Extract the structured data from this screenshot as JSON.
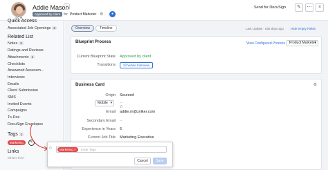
{
  "header": {
    "name": "Addie Mason",
    "rating": "4.0 ★",
    "status_badge": "Approved by client",
    "for_label": "for",
    "job_opening": "Product Marketer",
    "docusign_label": "Send for DocuSign"
  },
  "sidebar": {
    "quick_access": "Quick Access",
    "associated": "Associated Job Openings",
    "associated_count": "2",
    "related_list": "Related List",
    "items": [
      {
        "label": "Notes",
        "count": "2"
      },
      {
        "label": "Ratings and Reviews",
        "count": ""
      },
      {
        "label": "Attachments",
        "count": "1"
      },
      {
        "label": "Checklists",
        "count": ""
      },
      {
        "label": "Answered Assessm...",
        "count": ""
      },
      {
        "label": "Interviews",
        "count": ""
      },
      {
        "label": "Emails",
        "count": ""
      },
      {
        "label": "Client Submission",
        "count": ""
      },
      {
        "label": "SMS",
        "count": ""
      },
      {
        "label": "Invited Events",
        "count": ""
      },
      {
        "label": "Campaigns",
        "count": ""
      },
      {
        "label": "To-Dos",
        "count": ""
      },
      {
        "label": "DocuSign Envelopes",
        "count": ""
      }
    ],
    "tags_heading": "Tags",
    "tags_count": "1",
    "tag": "Marketing",
    "links_heading": "Links",
    "whats_this": "What's this?"
  },
  "main": {
    "tabs": [
      "Overview",
      "Timeline"
    ],
    "last_update": "Last Update : 835 days ago",
    "hide_fields": "Hide empty Fields",
    "blueprint": {
      "title": "Blueprint Process",
      "view_link": "View Configured Process",
      "process_select": "Product Marketer",
      "state_label": "Current Blueprint State",
      "state_value": "Approved by client",
      "transitions_label": "Transitions",
      "transition_button": "Schedule Interview"
    },
    "business_card": {
      "title": "Business Card",
      "fields": [
        {
          "label": "Origin",
          "value": "Sourced"
        },
        {
          "label": "Mobile",
          "value": "--"
        },
        {
          "label": "Email",
          "value": "addie.m@zylker.com"
        },
        {
          "label": "Secondary Email",
          "value": "--"
        },
        {
          "label": "Experience in Years",
          "value": "6"
        },
        {
          "label": "Current Job Title",
          "value": "Marketing Executive"
        }
      ]
    }
  },
  "popup": {
    "chip": "Marketing",
    "placeholder": "Enter Tags",
    "cancel": "Cancel",
    "save": "Save"
  }
}
